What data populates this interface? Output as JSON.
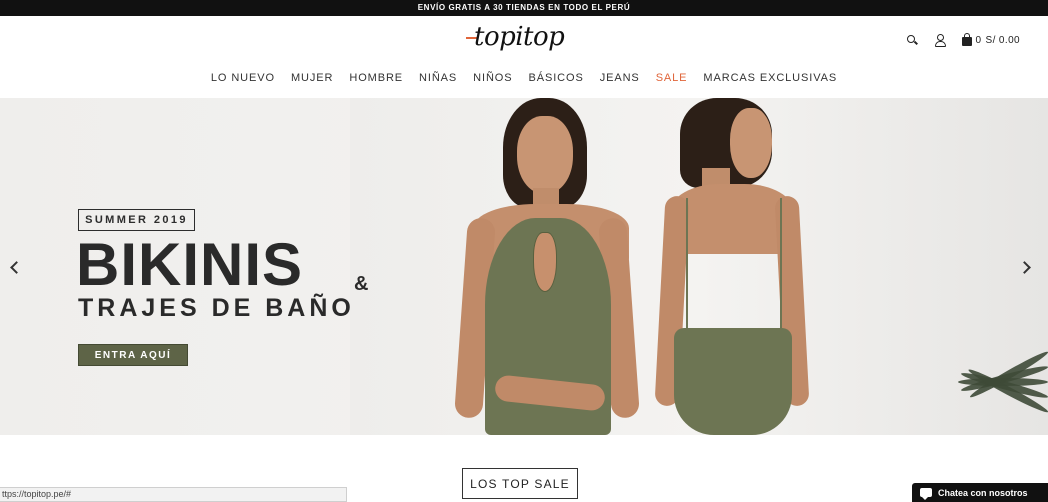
{
  "promo": {
    "text": "ENVÍO GRATIS A 30 TIENDAS EN TODO EL PERÚ"
  },
  "header": {
    "logo_text": "topitop",
    "cart_count": "0",
    "cart_total": "S/ 0.00",
    "icons": [
      "search-icon",
      "user-icon",
      "bag-icon"
    ]
  },
  "nav": {
    "items": [
      "LO NUEVO",
      "MUJER",
      "HOMBRE",
      "NIÑAS",
      "NIÑOS",
      "BÁSICOS",
      "JEANS",
      "SALE",
      "MARCAS EXCLUSIVAS"
    ]
  },
  "hero": {
    "badge": "SUMMER 2019",
    "title": "BIKINIS",
    "amp": "&",
    "subtitle": "TRAJES DE BAÑO",
    "cta": "ENTRA AQUÍ"
  },
  "sections": {
    "top_sale": "LOS TOP SALE"
  },
  "status_bar": {
    "url": "ttps://topitop.pe/#"
  },
  "chat": {
    "label": "Chatea con nosotros"
  },
  "colors": {
    "accent": "#e0653a",
    "swimsuit": "#6d7553",
    "cta_bg": "#5e6447",
    "promo_bg": "#111111"
  }
}
